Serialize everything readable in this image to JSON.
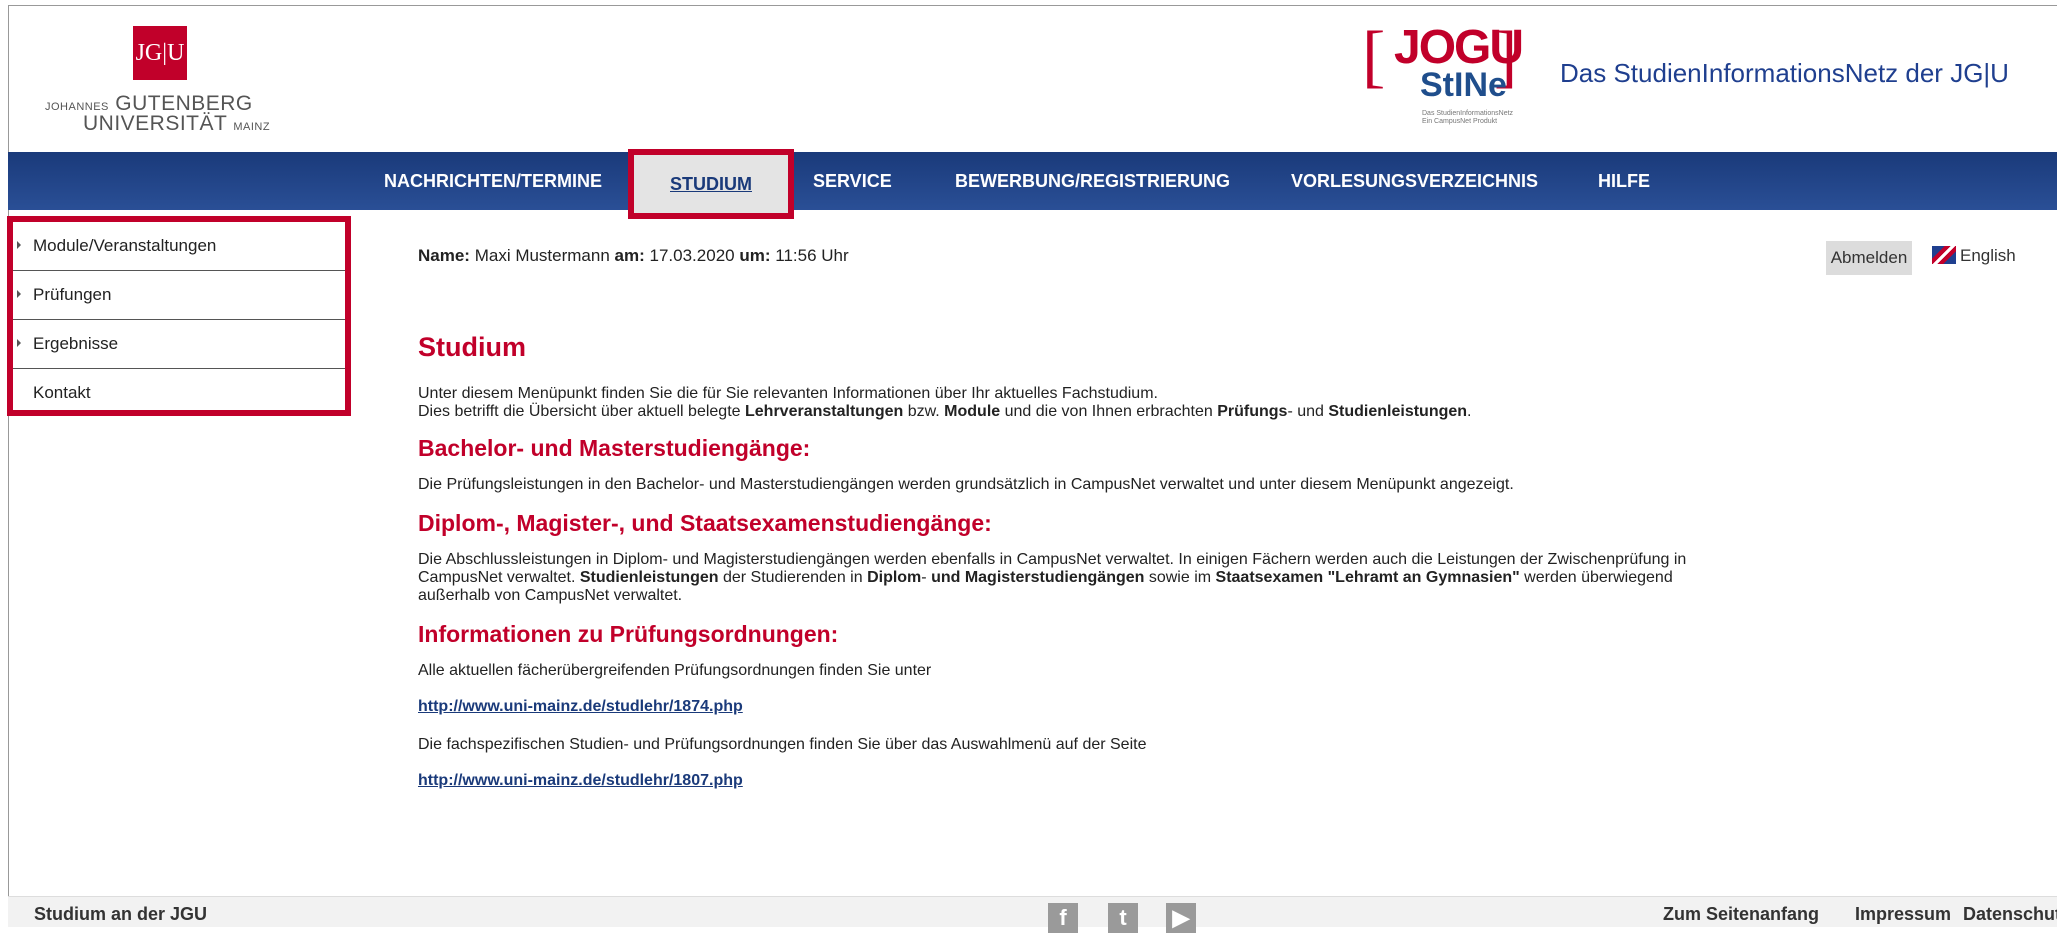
{
  "header": {
    "jgu_box": "JG|U",
    "jgu_line1_small": "JOHANNES",
    "jgu_line1": "GUTENBERG",
    "jgu_line2": "UNIVERSITÄT",
    "jgu_line2_small": "MAINZ",
    "stine_jogu": "JOGU",
    "stine_name": "StINe",
    "stine_small": "Das StudienInformationsNetz\nEin CampusNet Produkt",
    "tagline": "Das StudienInformationsNetz der JG|U"
  },
  "topnav": [
    {
      "label": "NACHRICHTEN/TERMINE"
    },
    {
      "label": "STUDIUM"
    },
    {
      "label": "SERVICE"
    },
    {
      "label": "BEWERBUNG/REGISTRIERUNG"
    },
    {
      "label": "VORLESUNGSVERZEICHNIS"
    },
    {
      "label": "HILFE"
    }
  ],
  "sidebar": [
    {
      "label": "Module/Veranstaltungen"
    },
    {
      "label": "Prüfungen"
    },
    {
      "label": "Ergebnisse"
    },
    {
      "label": "Kontakt"
    }
  ],
  "user": {
    "name_label": "Name:",
    "name": "Maxi Mustermann",
    "date_label": "am:",
    "date": "17.03.2020",
    "time_label": "um:",
    "time": "11:56 Uhr",
    "logout": "Abmelden",
    "language": "English"
  },
  "content": {
    "title": "Studium",
    "intro1": "Unter diesem Menüpunkt finden Sie die für Sie relevanten Informationen über Ihr aktuelles Fachstudium.",
    "intro2_a": "Dies betrifft die Übersicht über aktuell belegte ",
    "intro2_b": "Lehrveranstaltungen",
    "intro2_c": " bzw. ",
    "intro2_d": "Module",
    "intro2_e": " und die von Ihnen erbrachten ",
    "intro2_f": "Prüfungs",
    "intro2_g": "- und ",
    "intro2_h": "Studienleistungen",
    "intro2_i": ".",
    "h_bachelor": "Bachelor- und Masterstudiengänge:",
    "p_bachelor": "Die Prüfungsleistungen in den Bachelor- und Masterstudiengängen werden grundsätzlich in CampusNet verwaltet und unter diesem Menüpunkt angezeigt.",
    "h_diplom": "Diplom-, Magister-, und Staatsexamenstudiengänge:",
    "p_diplom_a": "Die Abschlussleistungen in Diplom- und Magisterstudiengängen werden ebenfalls in CampusNet verwaltet. In einigen Fächern werden auch die Leistungen der Zwischenprüfung in CampusNet verwaltet. ",
    "p_diplom_b": "Studienleistungen",
    "p_diplom_c": " der Studierenden in ",
    "p_diplom_d": "Diplom",
    "p_diplom_e": "- ",
    "p_diplom_f": "und Magisterstudiengängen",
    "p_diplom_g": " sowie im ",
    "p_diplom_h": "Staatsexamen \"Lehramt an Gymnasien\"",
    "p_diplom_i": " werden überwiegend außerhalb von CampusNet verwaltet.",
    "h_po": "Informationen zu Prüfungsordnungen:",
    "p_po1": "Alle aktuellen fächerübergreifenden Prüfungsordnungen finden Sie unter",
    "link1": "http://www.uni-mainz.de/studlehr/1874.php",
    "p_po2": "Die fachspezifischen Studien- und Prüfungsordnungen finden Sie über das Auswahlmenü auf der Seite",
    "link2": "http://www.uni-mainz.de/studlehr/1807.php"
  },
  "footer": {
    "left": "Studium an der JGU",
    "facebook": "f",
    "twitter": "t",
    "youtube": "▶",
    "top": "Zum Seitenanfang",
    "impressum": "Impressum",
    "datenschutz": "Datenschutz"
  },
  "colors": {
    "brand_red": "#c1002a",
    "nav_blue": "#1a3a7a"
  }
}
